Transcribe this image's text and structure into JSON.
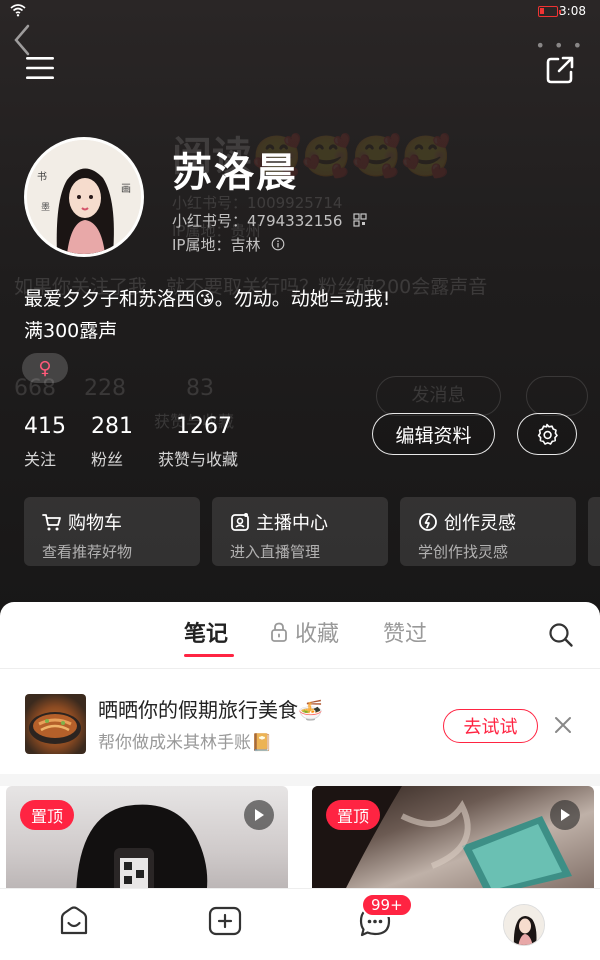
{
  "status_bar": {
    "time": "3:08"
  },
  "profile": {
    "nickname": "苏洛晨",
    "id_label": "小红书号：4794332156",
    "ip_label": "IP属地：吉林",
    "bio_line1": "最爱夕夕子和苏洛西😘。勿动。动她=动我!",
    "bio_line2": "满300露声",
    "gender_symbol": "♀"
  },
  "stats": [
    {
      "value": "415",
      "label": "关注"
    },
    {
      "value": "281",
      "label": "粉丝"
    },
    {
      "value": "1267",
      "label": "获赞与收藏"
    }
  ],
  "actions": {
    "edit_label": "编辑资料"
  },
  "shortcuts": [
    {
      "title": "购物车",
      "subtitle": "查看推荐好物",
      "icon": "cart-icon"
    },
    {
      "title": "主播中心",
      "subtitle": "进入直播管理",
      "icon": "live-icon"
    },
    {
      "title": "创作灵感",
      "subtitle": "学创作找灵感",
      "icon": "bulb-icon"
    }
  ],
  "ghost": {
    "row1": "阅读🥰🥰🥰🥰",
    "row2": "小红书号：1009925714",
    "row3": "IP属地：贵州",
    "row4": "如果你关注了我，就不要取关行吗？粉丝破200会露声音",
    "row5a": "668",
    "row5b": "228",
    "row5c": "83",
    "row6": "发消息",
    "row7": "获赞与收藏"
  },
  "tabs": {
    "notes": "笔记",
    "collect": "收藏",
    "liked": "赞过"
  },
  "promo": {
    "title": "晒晒你的假期旅行美食🍜",
    "subtitle": "帮你做成米其林手账📔",
    "button": "去试试"
  },
  "notes": [
    {
      "badge": "置顶"
    },
    {
      "badge": "置顶"
    }
  ],
  "bottom_nav": {
    "messages_badge": "99+"
  },
  "colors": {
    "accent": "#ff2442",
    "header_bg": "#1f1d1d"
  }
}
